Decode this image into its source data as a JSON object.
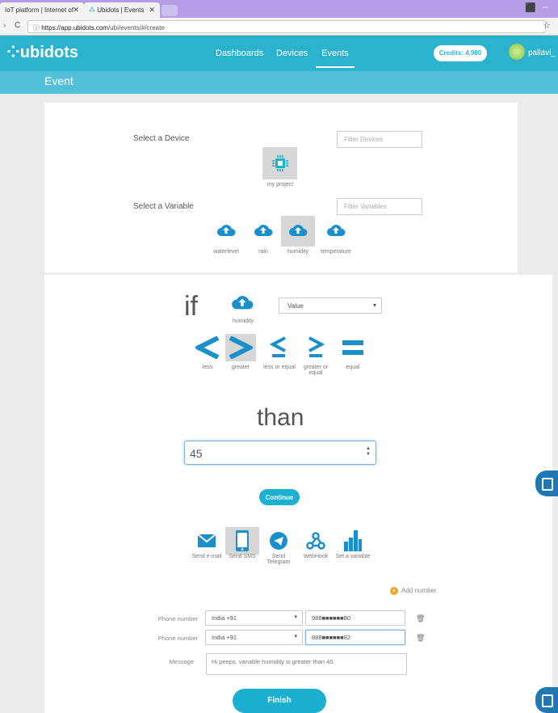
{
  "browser": {
    "tabs": [
      {
        "title": "IoT platform | Internet of"
      },
      {
        "title": "Ubidots | Events"
      }
    ],
    "url_secure": "https://app.ubidots.com",
    "url_path": "/ubi/events/#/create"
  },
  "nav": {
    "logo": "ubidots",
    "links": [
      "Dashboards",
      "Devices",
      "Events"
    ],
    "active": "Events",
    "credits": "Credits: 4,980",
    "username": "pallavi_"
  },
  "page_title": "Event",
  "device_section": {
    "label": "Select a Device",
    "filter_placeholder": "Filter Devices",
    "devices": [
      {
        "name": "my project",
        "selected": true
      }
    ]
  },
  "variable_section": {
    "label": "Select a Variable",
    "filter_placeholder": "Filter Variables",
    "variables": [
      {
        "name": "waterlevel",
        "selected": false
      },
      {
        "name": "rain",
        "selected": false
      },
      {
        "name": "humidity",
        "selected": true
      },
      {
        "name": "temperature",
        "selected": false
      }
    ]
  },
  "condition": {
    "if_word": "if",
    "variable": "humidity",
    "value_select": "Value",
    "operators": [
      {
        "label": "less",
        "symbol": "<",
        "selected": false
      },
      {
        "label": "greater",
        "symbol": ">",
        "selected": true
      },
      {
        "label": "less or equal",
        "symbol": "≤",
        "selected": false
      },
      {
        "label": "greater or equal",
        "symbol": "≥",
        "selected": false
      },
      {
        "label": "equal",
        "symbol": "=",
        "selected": false
      }
    ],
    "than_word": "than",
    "threshold": "45",
    "continue_label": "Continue"
  },
  "actions": {
    "items": [
      {
        "label": "Send e-mail",
        "icon": "envelope-icon",
        "selected": false
      },
      {
        "label": "Send SMS",
        "icon": "phone-icon",
        "selected": true
      },
      {
        "label": "Send Telegram",
        "icon": "telegram-icon",
        "selected": false
      },
      {
        "label": "WebHook",
        "icon": "webhook-icon",
        "selected": false
      },
      {
        "label": "Set a variable",
        "icon": "bar-chart-icon",
        "selected": false
      }
    ]
  },
  "sms_form": {
    "add_number": "Add number",
    "phone_label": "Phone number",
    "rows": [
      {
        "country": "India +91",
        "number": "988■■■■■■80"
      },
      {
        "country": "India +91",
        "number": "888■■■■■■82"
      }
    ],
    "message_label": "Message",
    "message": "Hi peeps, variable humidity is greater than 45",
    "finish_label": "Finish"
  },
  "colors": {
    "brand": "#2bb3cd",
    "button": "#1ab0d0",
    "selected_bg": "#d7d7d7",
    "icon_blue": "#1a8fc9"
  }
}
